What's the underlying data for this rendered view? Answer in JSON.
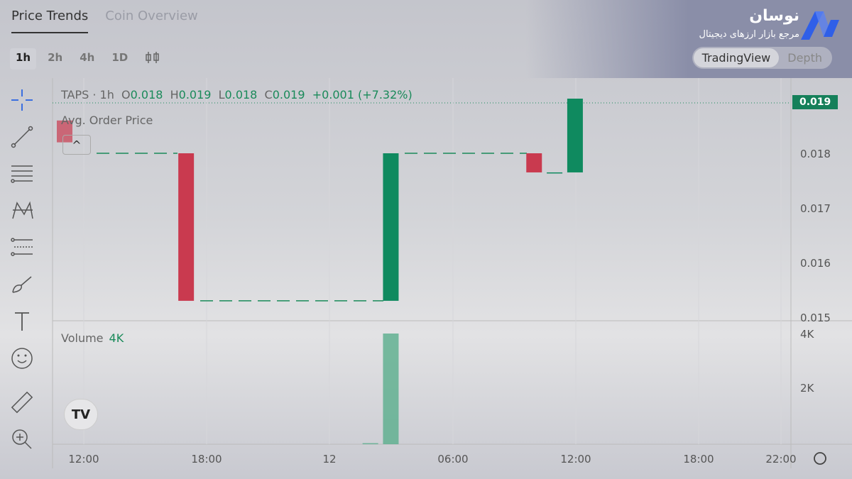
{
  "tabs": [
    {
      "label": "Price Trends",
      "active": true
    },
    {
      "label": "Coin Overview",
      "active": false
    }
  ],
  "intervals": [
    "1h",
    "2h",
    "4h",
    "1D"
  ],
  "brand": {
    "name": "نوسان",
    "tagline": "مرجع بازار ارزهای دیجیتال"
  },
  "view_toggle": [
    "TradingView",
    "Depth"
  ],
  "legend": {
    "symbol": "TAPS · 1h",
    "o_label": "O",
    "o": "0.018",
    "h_label": "H",
    "h": "0.019",
    "l_label": "L",
    "l": "0.018",
    "c_label": "C",
    "c": "0.019",
    "change": "+0.001 (+7.32%)"
  },
  "avg_order_label": "Avg. Order Price",
  "volume": {
    "label": "Volume",
    "value": "4K"
  },
  "last_price": "0.019",
  "colors": {
    "up": "#0f8a5f",
    "down": "#c93a4f",
    "accent": "#3b6fe0"
  },
  "tools": [
    "crosshair-icon",
    "trend-line-icon",
    "fib-icon",
    "pattern-icon",
    "projection-icon",
    "brush-icon",
    "text-icon",
    "emoji-icon",
    "ruler-icon",
    "zoom-in-icon"
  ],
  "chart_data": {
    "type": "candlestick",
    "x_ticks": [
      "12:00",
      "18:00",
      "12",
      "06:00",
      "12:00",
      "18:00",
      "22:00"
    ],
    "y_ticks": [
      "0.015",
      "0.016",
      "0.017",
      "0.018",
      "0.019"
    ],
    "ylim": [
      0.015,
      0.019
    ],
    "volume_ticks": [
      "2K",
      "4K"
    ],
    "candles": [
      {
        "t": "12:00",
        "o": 0.0186,
        "h": 0.0186,
        "l": 0.0182,
        "c": 0.0182
      },
      {
        "t": "17:00",
        "o": 0.018,
        "h": 0.018,
        "l": 0.0153,
        "c": 0.0153
      },
      {
        "t": "03:00",
        "o": 0.0153,
        "h": 0.018,
        "l": 0.0153,
        "c": 0.018
      },
      {
        "t": "10:00",
        "o": 0.018,
        "h": 0.018,
        "l": 0.01765,
        "c": 0.01765
      },
      {
        "t": "11:00",
        "o": 0.01765,
        "h": 0.01765,
        "l": 0.01765,
        "c": 0.01765
      },
      {
        "t": "12:00",
        "o": 0.01765,
        "h": 0.019,
        "l": 0.01765,
        "c": 0.019
      }
    ],
    "volumes": [
      {
        "t": "02:00",
        "v": 20
      },
      {
        "t": "03:00",
        "v": 4000
      }
    ]
  }
}
